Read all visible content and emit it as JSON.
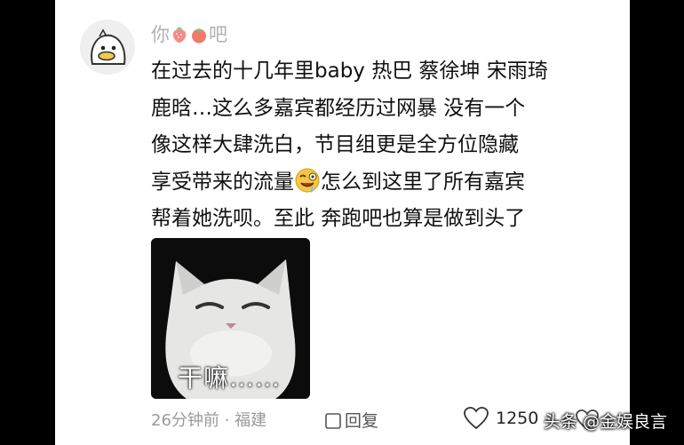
{
  "comment": {
    "username": "你吧",
    "username_icons": [
      "strawberry-icon",
      "tomato-icon"
    ],
    "lines": [
      "在过去的十几年里baby 热巴 蔡徐坤 宋雨琦",
      "鹿晗…这么多嘉宾都经历过网暴 没有一个",
      "像这样大肆洗白，节目组更是全方位隐藏",
      "享受带来的流量",
      "怎么到这里了所有嘉宾",
      "帮着她洗呗。至此 奔跑吧也算是做到头了"
    ],
    "inline_emoji": "drooling-face-icon",
    "meme_caption": "干嘛……",
    "time_location": "26分钟前 · 福建",
    "reply_label": "回复",
    "like_count": "1250"
  },
  "watermark": "头条 @金娱良言",
  "colors": {
    "panel_background": "#ffffff",
    "side_background": "#000000",
    "username": "#b0b0b0",
    "meta": "#9a9a9a"
  }
}
